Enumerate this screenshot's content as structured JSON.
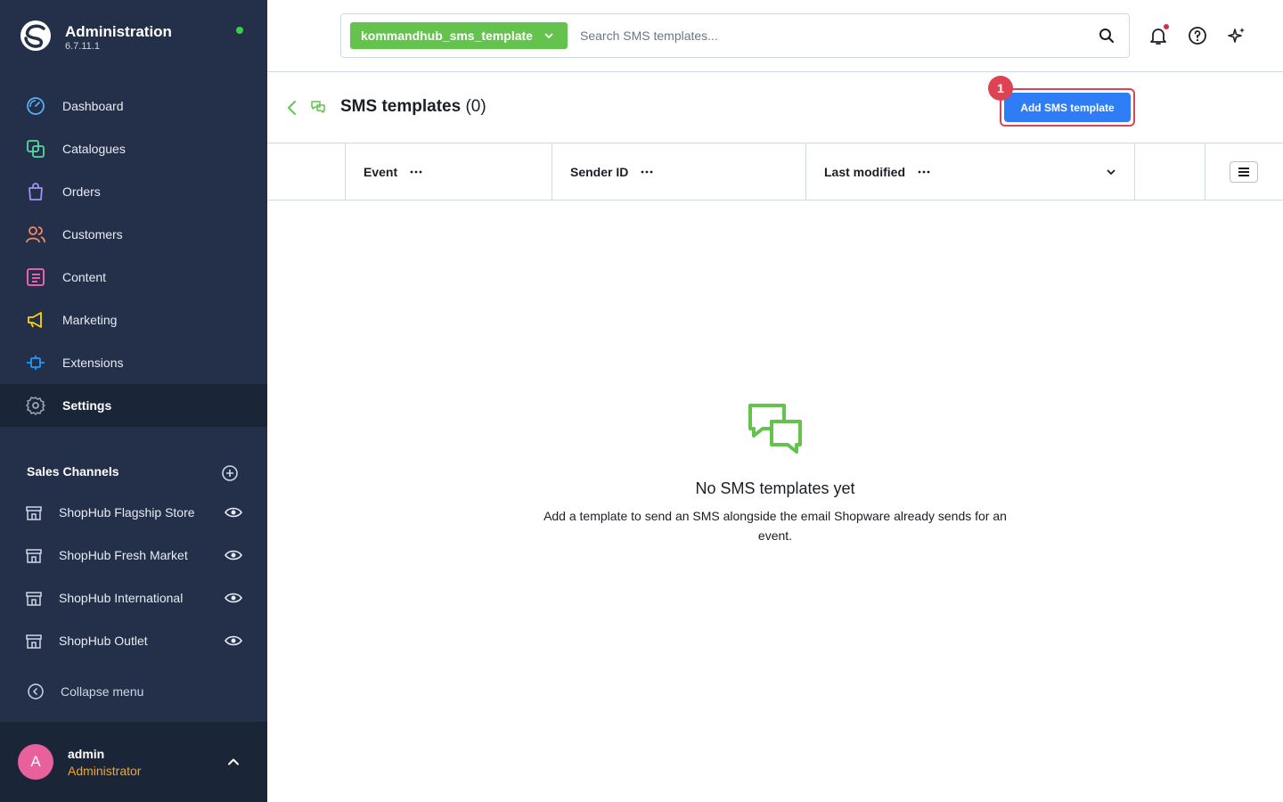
{
  "brand": {
    "title": "Administration",
    "version": "6.7.11.1"
  },
  "nav": {
    "items": [
      {
        "label": "Dashboard",
        "icon": "dashboard-icon",
        "color": "#57b0f5"
      },
      {
        "label": "Catalogues",
        "icon": "catalogue-icon",
        "color": "#57d9a3"
      },
      {
        "label": "Orders",
        "icon": "orders-icon",
        "color": "#a092f0"
      },
      {
        "label": "Customers",
        "icon": "customers-icon",
        "color": "#f88962"
      },
      {
        "label": "Content",
        "icon": "content-icon",
        "color": "#ff68b4"
      },
      {
        "label": "Marketing",
        "icon": "marketing-icon",
        "color": "#ffd700"
      },
      {
        "label": "Extensions",
        "icon": "extensions-icon",
        "color": "#189eff"
      },
      {
        "label": "Settings",
        "icon": "settings-icon",
        "color": "#9aa8b5",
        "active": true
      }
    ]
  },
  "sales_channels": {
    "header": "Sales Channels",
    "items": [
      {
        "label": "ShopHub Flagship Store"
      },
      {
        "label": "ShopHub Fresh Market"
      },
      {
        "label": "ShopHub International"
      },
      {
        "label": "ShopHub Outlet"
      }
    ]
  },
  "collapse": {
    "label": "Collapse menu"
  },
  "user": {
    "initial": "A",
    "name": "admin",
    "role": "Administrator"
  },
  "search": {
    "type_label": "kommandhub_sms_template",
    "placeholder": "Search SMS templates..."
  },
  "page": {
    "title": "SMS templates",
    "count": "(0)",
    "add_button": "Add SMS template",
    "step_badge": "1"
  },
  "table": {
    "columns": [
      {
        "label": "Event"
      },
      {
        "label": "Sender ID"
      },
      {
        "label": "Last modified"
      }
    ]
  },
  "empty_state": {
    "title": "No SMS templates yet",
    "description": "Add a template to send an SMS alongside the email Shopware already sends for an event."
  },
  "colors": {
    "sidebar": "#243049",
    "accent_green": "#64c34d",
    "primary_blue": "#2f7cf7",
    "highlight_red": "#de4353"
  }
}
